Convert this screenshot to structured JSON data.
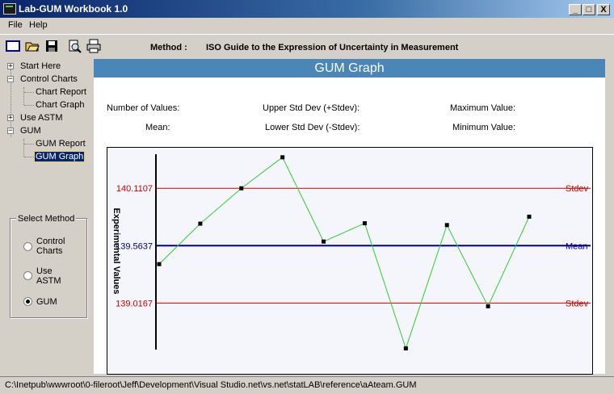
{
  "window": {
    "title": "Lab-GUM Workbook 1.0",
    "buttons": {
      "minimize": "_",
      "maximize": "□",
      "close": "X"
    }
  },
  "menu": [
    {
      "label": "File",
      "accel": "F"
    },
    {
      "label": "Help",
      "accel": "H"
    }
  ],
  "toolbar": {
    "icons": [
      "new-icon",
      "open-folder-icon",
      "save-icon",
      "preview-icon",
      "print-icon"
    ],
    "method_label": "Method :",
    "method_value": "ISO Guide to the Expression of Uncertainty in Measurement"
  },
  "tree": {
    "start": "Start Here",
    "control_charts": "Control Charts",
    "chart_report": "Chart Report",
    "chart_graph": "Chart Graph",
    "use_astm": "Use ASTM",
    "gum": "GUM",
    "gum_report": "GUM Report",
    "gum_graph": "GUM Graph"
  },
  "select_method": {
    "title": "Select Method",
    "options": [
      {
        "line1": "Control",
        "line2": "Charts",
        "selected": false
      },
      {
        "line1": "Use",
        "line2": "ASTM",
        "selected": false
      },
      {
        "line1": "GUM",
        "line2": "",
        "selected": true
      }
    ]
  },
  "panel": {
    "title": "GUM Graph",
    "stats": {
      "num_values": "Number of Values:",
      "mean": "Mean:",
      "upper_std": "Upper Std Dev (+Stdev):",
      "lower_std": "Lower Std Dev (-Stdev):",
      "max": "Maximum Value:",
      "min": "Minimum Value:"
    }
  },
  "chart_data": {
    "type": "line",
    "ylabel": "Experimental Values",
    "ylim": [
      138.65,
      140.42
    ],
    "y": [
      139.3877,
      139.7734,
      140.1106,
      140.406,
      139.603,
      139.777,
      138.5845,
      139.76,
      138.986,
      139.84
    ],
    "reference_lines": [
      {
        "value": 140.1107,
        "label": "140.1107",
        "right_label": "Stdev",
        "color": "#cc0000"
      },
      {
        "value": 139.5637,
        "label": "139.5637",
        "right_label": "Mean",
        "color": "#00008b"
      },
      {
        "value": 139.0167,
        "label": "139.0167",
        "right_label": "Stdev",
        "color": "#cc0000"
      }
    ],
    "series_color": "#33cc33"
  },
  "status": {
    "path": "C:\\Inetpub\\wwwroot\\0-fileroot\\Jeff\\Development\\Visual Studio.net\\vs.net\\statLAB\\reference\\aAteam.GUM"
  }
}
